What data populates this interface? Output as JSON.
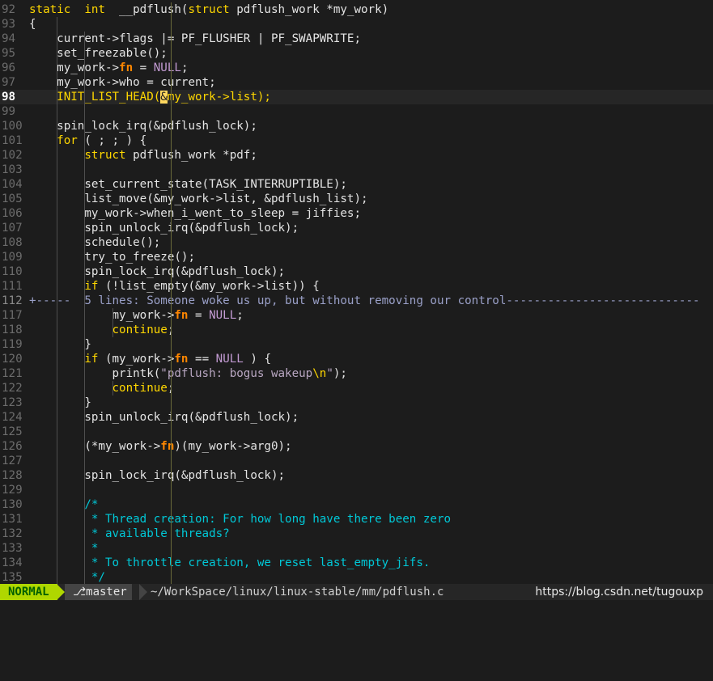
{
  "editor": {
    "lines": [
      {
        "num": "92",
        "code": [
          [
            "kw",
            "static"
          ],
          [
            "",
            "  "
          ],
          [
            "kw",
            "int"
          ],
          [
            "",
            "  __pdflush("
          ],
          [
            "kw",
            "struct"
          ],
          [
            "",
            " pdflush_work *my_work)"
          ]
        ]
      },
      {
        "num": "93",
        "code": [
          [
            "",
            "{"
          ]
        ]
      },
      {
        "num": "94",
        "code": [
          [
            "",
            "    current->flags |= PF_FLUSHER | PF_SWAPWRITE;"
          ]
        ]
      },
      {
        "num": "95",
        "code": [
          [
            "",
            "    set_freezable();"
          ]
        ]
      },
      {
        "num": "96",
        "code": [
          [
            "",
            "    my_work->"
          ],
          [
            "fn",
            "fn"
          ],
          [
            "",
            " = "
          ],
          [
            "nl",
            "NULL"
          ],
          [
            "",
            ";"
          ]
        ]
      },
      {
        "num": "97",
        "code": [
          [
            "",
            "    my_work->who = current;"
          ]
        ]
      },
      {
        "num": "98",
        "current": true,
        "code": [
          [
            "kw",
            "    INIT_LIST_HEAD("
          ],
          [
            "cur",
            "&"
          ],
          [
            "kw",
            "my_work->list);"
          ]
        ]
      },
      {
        "num": "99",
        "code": []
      },
      {
        "num": "100",
        "code": [
          [
            "",
            "    spin_lock_irq(&pdflush_lock);"
          ]
        ]
      },
      {
        "num": "101",
        "code": [
          [
            "kw",
            "    for"
          ],
          [
            "",
            " ( ; ; ) {"
          ]
        ]
      },
      {
        "num": "102",
        "code": [
          [
            "kw",
            "        struct"
          ],
          [
            "",
            " pdflush_work *pdf;"
          ]
        ]
      },
      {
        "num": "103",
        "code": []
      },
      {
        "num": "104",
        "code": [
          [
            "",
            "        set_current_state(TASK_INTERRUPTIBLE);"
          ]
        ]
      },
      {
        "num": "105",
        "code": [
          [
            "",
            "        list_move(&my_work->list, &pdflush_list);"
          ]
        ]
      },
      {
        "num": "106",
        "code": [
          [
            "",
            "        my_work->when_i_went_to_sleep = jiffies;"
          ]
        ]
      },
      {
        "num": "107",
        "code": [
          [
            "",
            "        spin_unlock_irq(&pdflush_lock);"
          ]
        ]
      },
      {
        "num": "108",
        "code": [
          [
            "",
            "        schedule();"
          ]
        ]
      },
      {
        "num": "109",
        "code": [
          [
            "",
            "        try_to_freeze();"
          ]
        ]
      },
      {
        "num": "110",
        "code": [
          [
            "",
            "        spin_lock_irq(&pdflush_lock);"
          ]
        ]
      },
      {
        "num": "111",
        "code": [
          [
            "kw",
            "        if"
          ],
          [
            "",
            " (!list_empty(&my_work->list)) {"
          ]
        ]
      },
      {
        "num": "112",
        "fold": true,
        "code": [
          [
            "",
            "+-----  5 lines: Someone woke us up, but without removing our control----------------------------"
          ]
        ]
      },
      {
        "num": "117",
        "code": [
          [
            "",
            "            my_work->"
          ],
          [
            "fn",
            "fn"
          ],
          [
            "",
            " = "
          ],
          [
            "nl",
            "NULL"
          ],
          [
            "",
            ";"
          ]
        ]
      },
      {
        "num": "118",
        "code": [
          [
            "kw",
            "            continue"
          ],
          [
            "",
            ";"
          ]
        ]
      },
      {
        "num": "119",
        "code": [
          [
            "",
            "        }"
          ]
        ]
      },
      {
        "num": "120",
        "code": [
          [
            "kw",
            "        if"
          ],
          [
            "",
            " (my_work->"
          ],
          [
            "fn",
            "fn"
          ],
          [
            "",
            " == "
          ],
          [
            "nl",
            "NULL"
          ],
          [
            "",
            " ) {"
          ]
        ]
      },
      {
        "num": "121",
        "code": [
          [
            "",
            "            printk("
          ],
          [
            "str",
            "\"pdflush: bogus wakeup"
          ],
          [
            "esc",
            "\\n"
          ],
          [
            "str",
            "\""
          ],
          [
            "",
            ");"
          ]
        ]
      },
      {
        "num": "122",
        "code": [
          [
            "kw",
            "            continue"
          ],
          [
            "",
            ";"
          ]
        ]
      },
      {
        "num": "123",
        "code": [
          [
            "",
            "        }"
          ]
        ]
      },
      {
        "num": "124",
        "code": [
          [
            "",
            "        spin_unlock_irq(&pdflush_lock);"
          ]
        ]
      },
      {
        "num": "125",
        "code": []
      },
      {
        "num": "126",
        "code": [
          [
            "",
            "        (*my_work->"
          ],
          [
            "fn",
            "fn"
          ],
          [
            "",
            ")(my_work->arg0);"
          ]
        ]
      },
      {
        "num": "127",
        "code": []
      },
      {
        "num": "128",
        "code": [
          [
            "",
            "        spin_lock_irq(&pdflush_lock);"
          ]
        ]
      },
      {
        "num": "129",
        "code": []
      },
      {
        "num": "130",
        "code": [
          [
            "cm",
            "        /*"
          ]
        ]
      },
      {
        "num": "131",
        "code": [
          [
            "cm",
            "         * Thread creation: For how long have there been zero"
          ]
        ]
      },
      {
        "num": "132",
        "code": [
          [
            "cm",
            "         * available threads?"
          ]
        ]
      },
      {
        "num": "133",
        "code": [
          [
            "cm",
            "         *"
          ]
        ]
      },
      {
        "num": "134",
        "code": [
          [
            "cm",
            "         * To throttle creation, we reset last_empty_jifs."
          ]
        ]
      },
      {
        "num": "135",
        "code": [
          [
            "cm",
            "         */"
          ]
        ]
      }
    ]
  },
  "statusbar": {
    "mode": "NORMAL",
    "branch_icon": "⎇",
    "branch": "master",
    "filepath": "~/WorkSpace/linux/linux-stable/mm/pdflush.c",
    "mode_color": "#afd700"
  },
  "watermark": "https://blog.csdn.net/tugouxp"
}
